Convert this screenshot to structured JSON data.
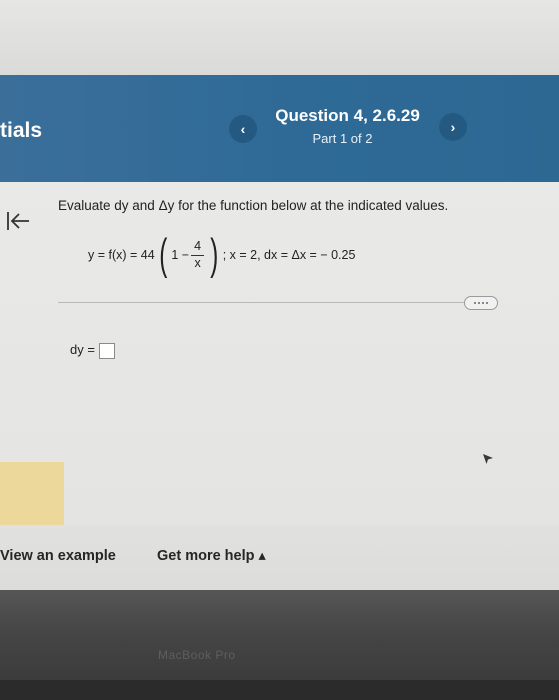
{
  "app": {
    "brand": "tials"
  },
  "header": {
    "question_title": "Question 4, 2.6.29",
    "question_sub": "Part 1 of 2",
    "prev_glyph": "‹",
    "next_glyph": "›"
  },
  "problem": {
    "prompt": "Evaluate dy and Δy for the function below at the indicated values.",
    "formula": {
      "lhs": "y = f(x) = 44",
      "inner_lead": "1 −",
      "frac_num": "4",
      "frac_den": "x",
      "rhs": "; x = 2, dx = Δx = − 0.25"
    }
  },
  "answer": {
    "label": "dy =",
    "value": ""
  },
  "footer": {
    "view_example": "View an example",
    "get_help": "Get more help ▴"
  },
  "watermark": "MacBook Pro",
  "colors": {
    "header_bg": "#2f6a97",
    "nav_button_bg": "#245a82",
    "sidebar_highlight": "#ecd89a"
  }
}
